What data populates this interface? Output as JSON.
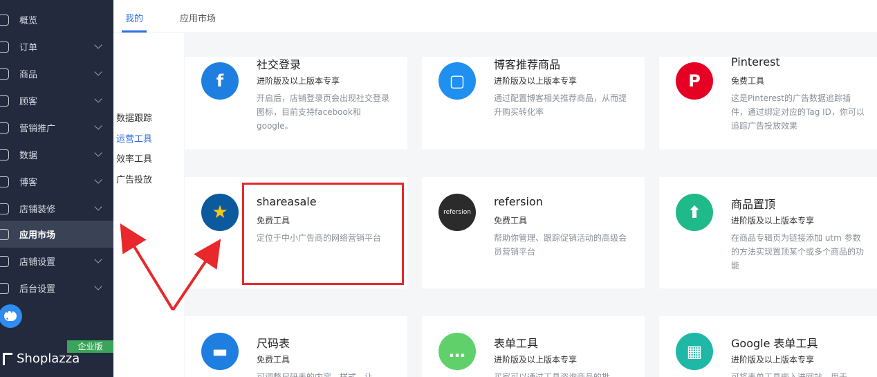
{
  "sidebar": {
    "items": [
      {
        "label": "概览",
        "icon": "dashboard-icon",
        "chevron": false
      },
      {
        "label": "订单",
        "icon": "order-icon",
        "chevron": true
      },
      {
        "label": "商品",
        "icon": "product-icon",
        "chevron": true
      },
      {
        "label": "顾客",
        "icon": "customer-icon",
        "chevron": true
      },
      {
        "label": "营销推广",
        "icon": "marketing-icon",
        "chevron": true
      },
      {
        "label": "数据",
        "icon": "analytics-icon",
        "chevron": true
      },
      {
        "label": "博客",
        "icon": "blog-icon",
        "chevron": true
      },
      {
        "label": "店铺装修",
        "icon": "theme-icon",
        "chevron": true
      },
      {
        "label": "应用市场",
        "icon": "apps-icon",
        "chevron": false,
        "active": true
      },
      {
        "label": "店铺设置",
        "icon": "settings-icon",
        "chevron": true
      },
      {
        "label": "后台设置",
        "icon": "admin-icon",
        "chevron": true
      }
    ],
    "brand_name": "Shoplazza",
    "edition_badge": "企业版"
  },
  "subnav": {
    "items": [
      "数据跟踪",
      "运营工具",
      "效率工具",
      "广告投放"
    ],
    "active_index": 1
  },
  "tabs": [
    {
      "label": "我的",
      "active": true
    },
    {
      "label": "应用市场",
      "active": false
    }
  ],
  "cards": [
    {
      "title": "社交登录",
      "tag": "进阶版及以上版本专享",
      "desc": "开启后，店铺登录页会出现社交登录图标，目前支持facebook和google。",
      "icon": "facebook-icon",
      "color": "#1f7fe0"
    },
    {
      "title": "博客推荐商品",
      "tag": "进阶版及以上版本专享",
      "desc": "通过配置博客相关推荐商品，从而提升购买转化率",
      "icon": "bag-icon",
      "color": "#1f8ff0"
    },
    {
      "title": "Pinterest",
      "tag": "免费工具",
      "desc": "这是Pinterest的广告数据追踪插件，通过绑定对应的Tag ID，你可以追踪广告投放效果",
      "icon": "pinterest-icon",
      "color": "#e60023"
    },
    {
      "title": "shareasale",
      "tag": "免费工具",
      "desc": "定位于中小广告商的网络营销平台",
      "icon": "star-icon",
      "color": "#0c5a9e"
    },
    {
      "title": "refersion",
      "tag": "免费工具",
      "desc": "帮助你管理、跟踪促销活动的高级会员营销平台",
      "icon": "refersion-logo-icon",
      "logo_text": "refersion",
      "color": "#2b2b2b"
    },
    {
      "title": "商品置顶",
      "tag": "进阶版及以上版本专享",
      "desc": "在商品专辑页为链接添加 utm 参数的方法实现置顶某个或多个商品的功能",
      "icon": "pin-top-icon",
      "color": "#20b98a"
    },
    {
      "title": "尺码表",
      "tag": "免费工具",
      "desc": "可调整尺码表的内容、样式，让",
      "icon": "ruler-icon",
      "color": "#1f7fe0"
    },
    {
      "title": "表单工具",
      "tag": "进阶版及以上版本专享",
      "desc": "买家可以通过工具咨询商品的批",
      "icon": "chat-bubble-icon",
      "color": "#5fd06a"
    },
    {
      "title": "Google 表单工具",
      "tag": "进阶版及以上版本专享",
      "desc": "可将表单工具嵌入进网站，用于",
      "icon": "table-icon",
      "color": "#1fb8a6"
    }
  ],
  "colors": {
    "sidebar_bg": "#232a3d",
    "accent": "#2f6fe0",
    "annotation_red": "#e8282b"
  }
}
